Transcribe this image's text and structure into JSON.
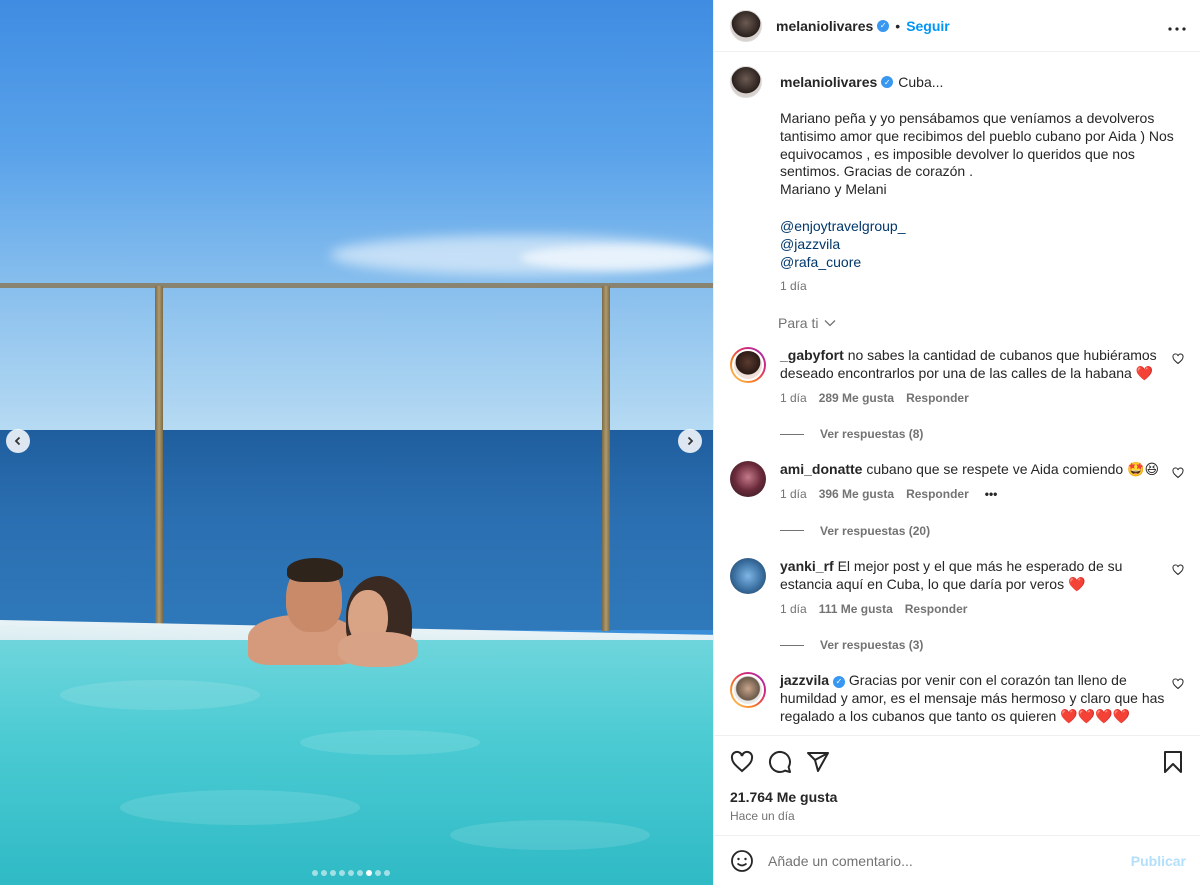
{
  "post": {
    "username": "melaniolivares",
    "follow_label": "Seguir",
    "bullet": "•",
    "more_label": "•••"
  },
  "caption": {
    "username": "melaniolivares",
    "title": "Cuba...",
    "text": "Mariano peña y yo pensábamos que veníamos a devolveros tantisimo amor que recibimos del pueblo cubano por Aida ) Nos equivocamos , es imposible devolver lo queridos que nos sentimos. Gracias de corazón .\nMariano y Melani",
    "mentions": [
      "@enjoytravelgroup_",
      "@jazzvila",
      "@rafa_cuore"
    ],
    "time": "1 día"
  },
  "para_ti": "Para ti",
  "comments": [
    {
      "username": "_gabyfort",
      "text": "no sabes la cantidad de cubanos que hubiéramos deseado encontrarlos por una de las calles de la habana",
      "emoji": "❤️",
      "time": "1 día",
      "likes": "289 Me gusta",
      "reply": "Responder",
      "replies": "Ver respuestas (8)"
    },
    {
      "username": "ami_donatte",
      "text": "cubano que se respete ve Aida comiendo",
      "emoji": "🤩😆",
      "time": "1 día",
      "likes": "396 Me gusta",
      "reply": "Responder",
      "replies": "Ver respuestas (20)",
      "options": "•••"
    },
    {
      "username": "yanki_rf",
      "text": "El mejor post y el que más he esperado de su estancia aquí en Cuba, lo que daría por veros",
      "emoji": "❤️",
      "time": "1 día",
      "likes": "111 Me gusta",
      "reply": "Responder",
      "replies": "Ver respuestas (3)"
    },
    {
      "username": "jazzvila",
      "text": "Gracias por venir con el corazón tan lleno de humildad y amor, es el mensaje más hermoso y claro que has regalado a los cubanos que tanto os quieren",
      "emoji": "❤️❤️❤️❤️"
    }
  ],
  "likes_count": "21.764 Me gusta",
  "posted": "Hace un día",
  "composer": {
    "placeholder": "Añade un comentario...",
    "publish": "Publicar"
  },
  "carousel": {
    "total": 9,
    "active_index": 6
  },
  "icons": {
    "header_more": "more-horizontal-icon",
    "like": "heart-icon",
    "comment": "comment-icon",
    "share": "share-icon",
    "save": "bookmark-icon",
    "emoji": "emoji-icon",
    "prev": "chevron-left-icon",
    "next": "chevron-right-icon"
  },
  "colors": {
    "accent": "#0095f6",
    "verified": "#3897f0",
    "heart": "#ed4956",
    "publish_disabled": "#b2dffc"
  }
}
